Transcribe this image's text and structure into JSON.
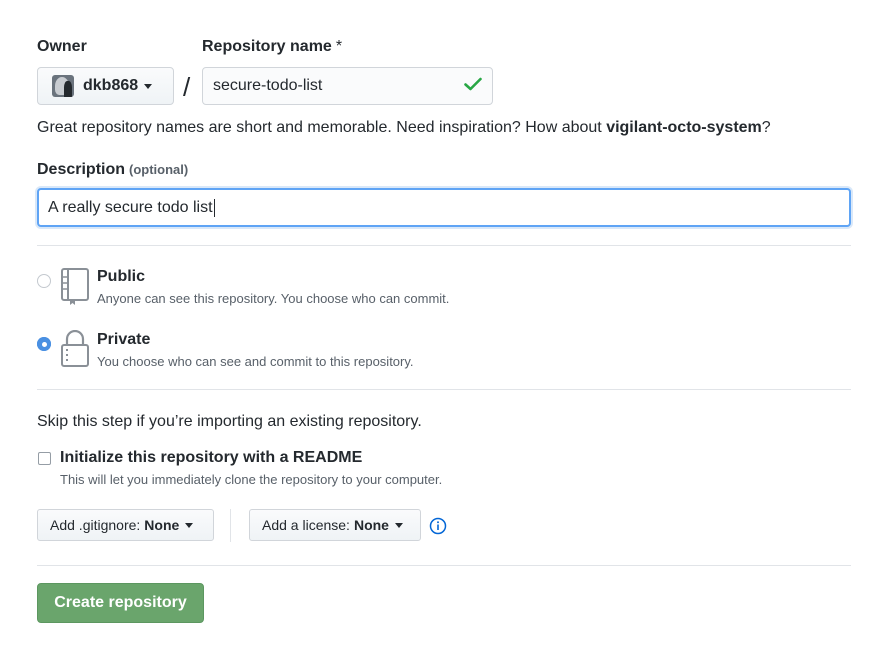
{
  "owner": {
    "label": "Owner",
    "value": "dkb868"
  },
  "repository": {
    "label": "Repository name",
    "required_mark": "*",
    "separator": "/",
    "value": "secure-todo-list",
    "valid_icon": "check-icon"
  },
  "name_help": {
    "text": "Great repository names are short and memorable. Need inspiration? How about ",
    "suggestion": "vigilant-octo-system",
    "suffix": "?"
  },
  "description": {
    "label": "Description",
    "optional": "(optional)",
    "value": "A really secure todo list"
  },
  "visibility": {
    "options": [
      {
        "title": "Public",
        "subtitle": "Anyone can see this repository. You choose who can commit.",
        "icon": "repo-icon",
        "selected": false
      },
      {
        "title": "Private",
        "subtitle": "You choose who can see and commit to this repository.",
        "icon": "lock-icon",
        "selected": true
      }
    ]
  },
  "init": {
    "skip_text": "Skip this step if you’re importing an existing repository.",
    "readme_label": "Initialize this repository with a README",
    "readme_sub": "This will let you immediately clone the repository to your computer.",
    "readme_checked": false
  },
  "gitignore": {
    "label": "Add .gitignore:",
    "value": "None"
  },
  "license": {
    "label": "Add a license:",
    "value": "None",
    "info_icon": "info-icon"
  },
  "submit": {
    "label": "Create repository"
  },
  "colors": {
    "accent_blue": "#4a90e2",
    "success_green": "#28a745",
    "create_button": "#6aa56c",
    "muted_text": "#586069"
  }
}
